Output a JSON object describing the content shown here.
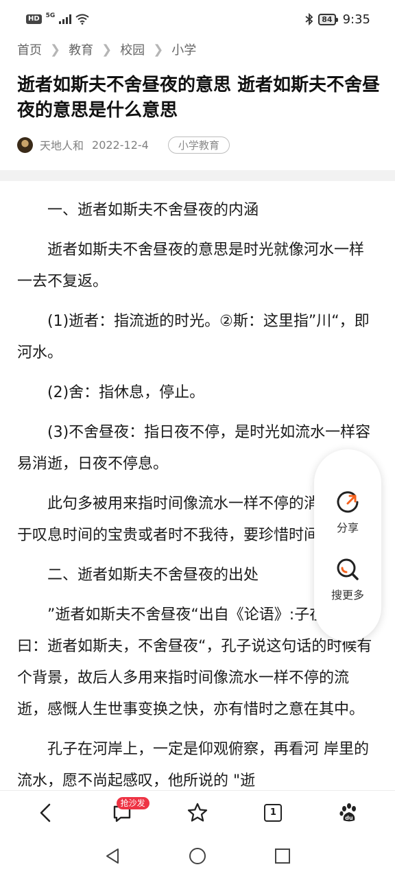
{
  "status_bar": {
    "left_badge": "HD",
    "network": "5G",
    "battery": "84",
    "time": "9:35"
  },
  "breadcrumb": [
    "首页",
    "教育",
    "校园",
    "小学"
  ],
  "article": {
    "title": "逝者如斯夫不舍昼夜的意思 逝者如斯夫不舍昼夜的意思是什么意思",
    "author": "天地人和",
    "date": "2022-12-4",
    "tag": "小学教育",
    "paragraphs": [
      "一、逝者如斯夫不舍昼夜的内涵",
      "逝者如斯夫不舍昼夜的意思是时光就像河水一样一去不复返。",
      "(1)逝者：指流逝的时光。②斯：这里指”川“，即河水。",
      "(2)舍：指休息，停止。",
      "(3)不舍昼夜：指日夜不停，是时光如流水一样容易消逝，日夜不停息。",
      "此句多被用来指时间像流水一样不停的消逝，用于叹息时间的宝贵或者时不我待，要珍惜时间等。",
      "二、逝者如斯夫不舍昼夜的出处",
      "”逝者如斯夫不舍昼夜“出自《论语》:子在川上曰：逝者如斯夫，不舍昼夜“，孔子说这句话的时候有个背景，故后人多用来指时间像流水一样不停的流逝，感慨人生世事变换之快，亦有惜时之意在其中。",
      "孔子在河岸上，一定是仰观俯察，再看河 岸里的流水，愿不尚起感叹，他所说的 \"逝"
    ]
  },
  "float_panel": {
    "share_label": "分享",
    "search_more_label": "搜更多"
  },
  "toolbar": {
    "comment_badge": "抢沙发",
    "tab_count": "1"
  },
  "colors": {
    "accent_orange": "#f5621e",
    "badge_red": "#ee3344"
  }
}
